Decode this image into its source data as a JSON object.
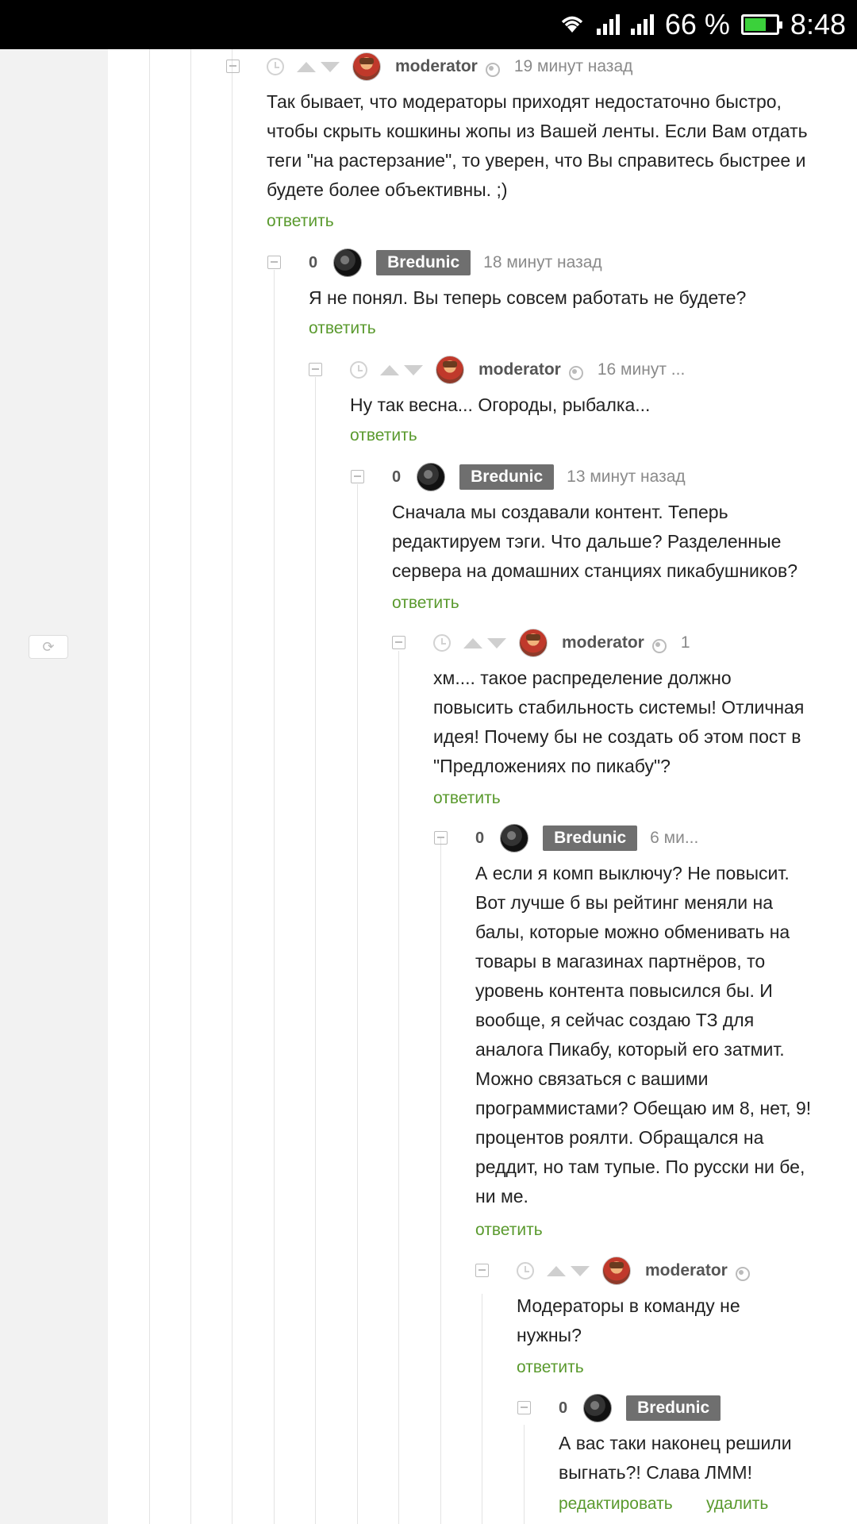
{
  "status_bar": {
    "battery_percent": "66 %",
    "time": "8:48",
    "battery_level": 0.66
  },
  "comments": [
    {
      "user": "moderator",
      "time": "19 минут назад",
      "text": "Так бывает, что модераторы приходят недостаточно быстро, чтобы скрыть кошкины жопы из Вашей ленты. Если Вам отдать теги \"на растерзание\", то уверен, что Вы справитесь быстрее и будете более объективны. ;)",
      "reply": "ответить"
    },
    {
      "user": "Bredunic",
      "rating": "0",
      "time": "18 минут назад",
      "text": "Я не понял. Вы теперь совсем работать не будете?",
      "reply": "ответить"
    },
    {
      "user": "moderator",
      "time": "16 минут ...",
      "text": "Ну так весна... Огороды, рыбалка...",
      "reply": "ответить"
    },
    {
      "user": "Bredunic",
      "rating": "0",
      "time": "13 минут назад",
      "text": "Сначала мы создавали контент. Теперь редактируем тэги. Что дальше? Разделенные сервера на домашних станциях пикабушников?",
      "reply": "ответить"
    },
    {
      "user": "moderator",
      "time": "1",
      "text": "хм.... такое распределение должно повысить стабильность системы! Отличная идея! Почему бы не создать об этом пост в \"Предложениях по пикабу\"?",
      "reply": "ответить"
    },
    {
      "user": "Bredunic",
      "rating": "0",
      "time": "6 ми...",
      "text": "А если я комп выключу? Не повысит. Вот лучше б вы рейтинг меняли на балы, которые можно обменивать на товары в магазинах партнёров, то уровень контента повысился бы. И вообще, я сейчас создаю ТЗ для аналога Пикабу, который его затмит. Можно связаться с вашими программистами? Обещаю им 8, нет, 9! процентов роялти. Обращался на реддит, но там тупые. По русски ни бе, ни ме.",
      "reply": "ответить"
    },
    {
      "user": "moderator",
      "time": "",
      "text": "Модераторы в команду не нужны?",
      "reply": "ответить"
    },
    {
      "user": "Bredunic",
      "rating": "0",
      "time": "",
      "text": "А вас таки наконец решили выгнать?! Слава ЛММ!",
      "edit": "редактировать",
      "delete": "удалить"
    }
  ]
}
